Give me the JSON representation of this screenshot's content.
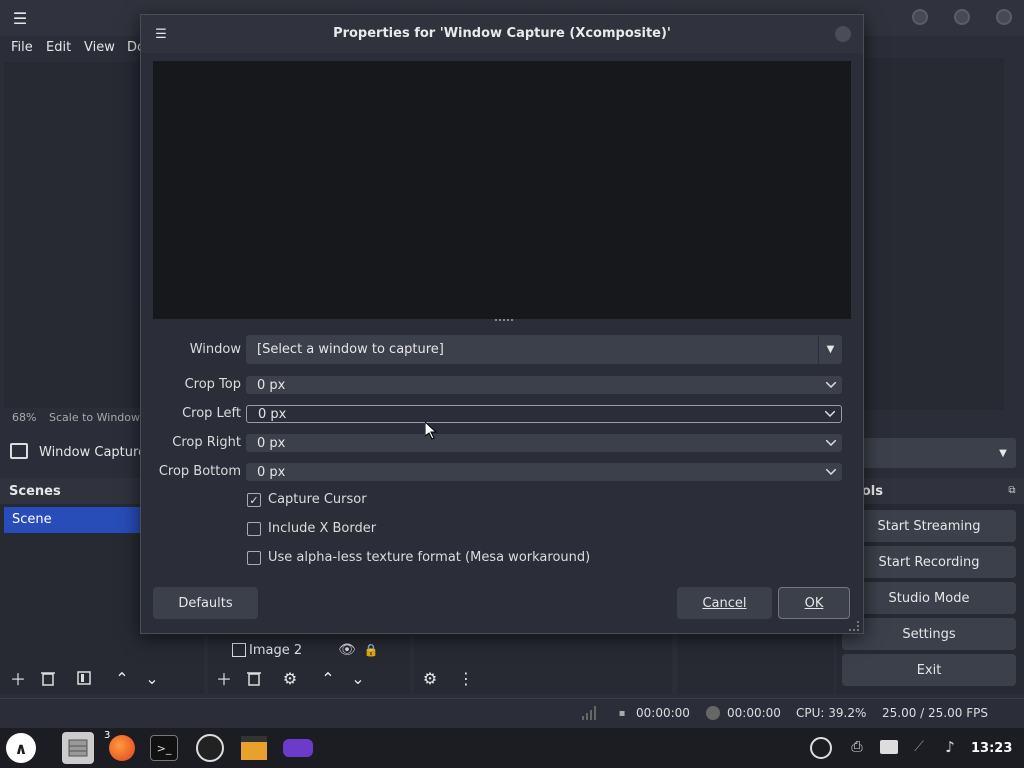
{
  "app": {
    "menu": [
      "File",
      "Edit",
      "View",
      "Do"
    ],
    "scale_percent": "68%",
    "scale_label": "Scale to Window",
    "source_name": "Window Capture",
    "scenes_title": "Scenes",
    "scene_item": "Scene",
    "controls_title": "ntrols",
    "controls": [
      "Start Streaming",
      "Start Recording",
      "Studio Mode",
      "Settings",
      "Exit"
    ],
    "source_row": {
      "name": "Image 2"
    },
    "status": {
      "stream_time": "00:00:00",
      "rec_time": "00:00:00",
      "cpu": "CPU: 39.2%",
      "fps": "25.00 / 25.00 FPS"
    }
  },
  "dialog": {
    "title": "Properties for 'Window Capture (Xcomposite)'",
    "fields": [
      {
        "label": "Window",
        "value": "[Select a window to capture]"
      },
      {
        "label": "Crop Top",
        "value": "0 px"
      },
      {
        "label": "Crop Left",
        "value": "0 px"
      },
      {
        "label": "Crop Right",
        "value": "0 px"
      },
      {
        "label": "Crop Bottom",
        "value": "0 px"
      }
    ],
    "checkboxes": [
      {
        "label": "Capture Cursor",
        "checked": true
      },
      {
        "label": "Include X Border",
        "checked": false
      },
      {
        "label": "Use alpha-less texture format (Mesa workaround)",
        "checked": false
      }
    ],
    "defaults_label": "Defaults",
    "cancel_label": "Cancel",
    "ok_label": "OK"
  },
  "taskbar": {
    "clock": "13:23",
    "badge": "3"
  },
  "icons": {
    "accent": "#284cb8",
    "bg": "#2b2e38"
  }
}
